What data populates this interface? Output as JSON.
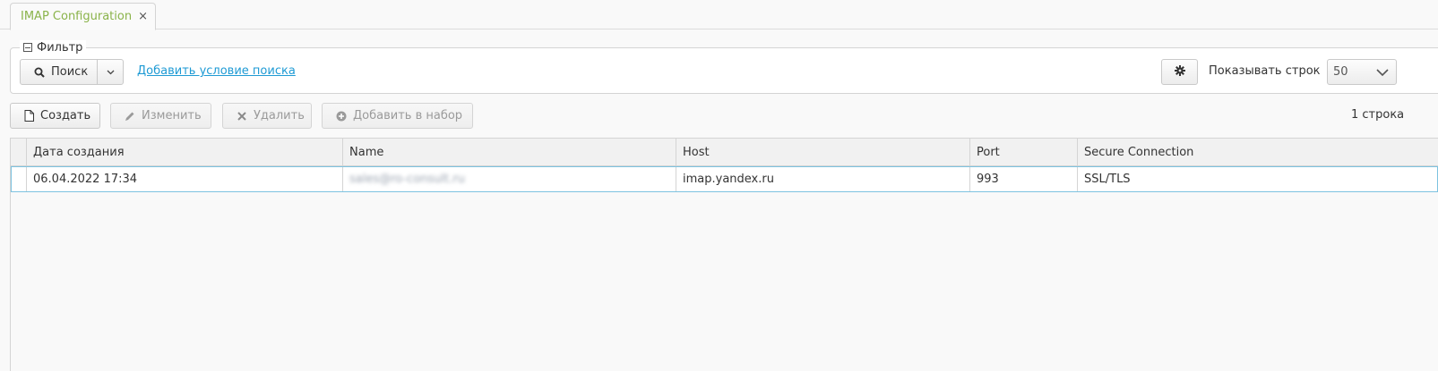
{
  "tabs": [
    {
      "label": "IMAP Configuration",
      "close": "×"
    }
  ],
  "filter": {
    "legend": "Фильтр",
    "search_label": "Поиск",
    "add_condition": "Добавить условие поиска",
    "rows_label": "Показывать строк",
    "rows_value": "50"
  },
  "toolbar": {
    "create": "Создать",
    "edit": "Изменить",
    "delete": "Удалить",
    "add_to_set": "Добавить в набор",
    "row_count": "1 строка"
  },
  "table": {
    "columns": [
      "Дата создания",
      "Name",
      "Host",
      "Port",
      "Secure Connection"
    ],
    "rows": [
      [
        "06.04.2022 17:34",
        "sales@ro-consult.ru",
        "imap.yandex.ru",
        "993",
        "SSL/TLS"
      ]
    ]
  },
  "colors": {
    "tab_text": "#8ab34a",
    "link": "#1e9ad4",
    "selected_row_border": "#7dc3e0"
  },
  "icons": {
    "search": "search-icon",
    "dropdown": "chevron-down-icon",
    "gear": "gear-icon",
    "create": "file-icon",
    "edit": "pencil-icon",
    "delete": "close-icon",
    "add_to_set": "plus-circle-icon",
    "collapse": "minus-square-icon"
  }
}
